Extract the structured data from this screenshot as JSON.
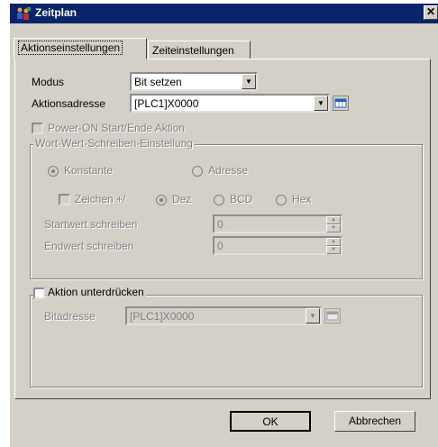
{
  "window": {
    "title": "Zeitplan",
    "close_glyph": "✕",
    "app_icon": "people-icon",
    "close_icon": "close-icon"
  },
  "tabs": [
    {
      "label": "Aktionseinstellungen",
      "active": true
    },
    {
      "label": "Zeiteinstellungen",
      "active": false
    }
  ],
  "modus": {
    "label": "Modus",
    "value": "Bit setzen"
  },
  "aktionsadresse": {
    "label": "Aktionsadresse",
    "value": "[PLC1]X0000",
    "icon": "calendar-icon"
  },
  "power_on": {
    "label": "Power-ON Start/Ende Aktion",
    "checked": false
  },
  "wort_wert": {
    "group_label": "Wort-Wert-Schreiben-Einstellung",
    "source_options": [
      {
        "label": "Konstante",
        "selected": true
      },
      {
        "label": "Adresse",
        "selected": false
      }
    ],
    "sign_checkbox": {
      "label": "Zeichen +/",
      "checked": false
    },
    "format_options": [
      {
        "label": "Dez",
        "selected": true
      },
      {
        "label": "BCD",
        "selected": false
      },
      {
        "label": "Hex",
        "selected": false
      }
    ],
    "startwert": {
      "label": "Startwert schreiben",
      "value": "0"
    },
    "endwert": {
      "label": "Endwert schreiben",
      "value": "0"
    }
  },
  "aktion_unterdruecken": {
    "label": "Aktion unterdrücken",
    "checked": false,
    "bitadresse": {
      "label": "Bitadresse",
      "value": "[PLC1]X0000"
    }
  },
  "buttons": {
    "ok": "OK",
    "cancel": "Abbrechen"
  },
  "colors": {
    "titlebar": "#0a246a",
    "face": "#d4d0c8",
    "disabled_text": "#808080"
  }
}
